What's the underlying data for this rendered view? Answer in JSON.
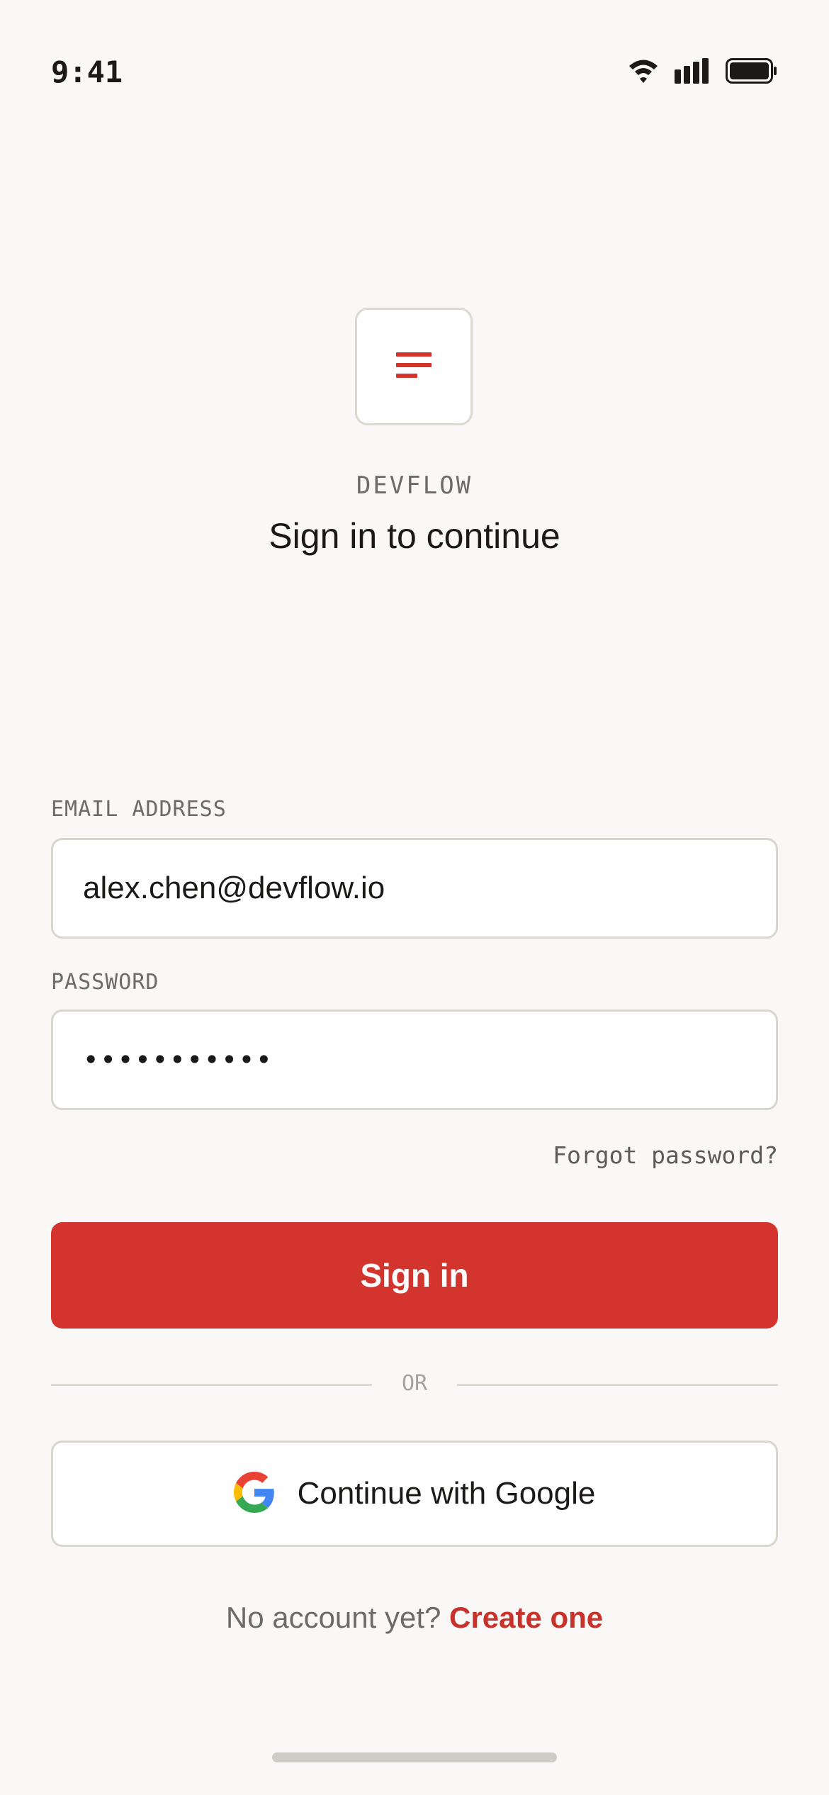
{
  "status_bar": {
    "time": "9:41"
  },
  "brand": {
    "name": "DEVFLOW",
    "accent_color": "#d3342e"
  },
  "heading": "Sign in to continue",
  "form": {
    "email": {
      "label": "EMAIL ADDRESS",
      "value": "alex.chen@devflow.io"
    },
    "password": {
      "label": "PASSWORD",
      "masked_value": "•••••••••••"
    },
    "forgot_password": "Forgot password?",
    "submit_label": "Sign in"
  },
  "divider": "OR",
  "social_login": {
    "google_label": "Continue with Google",
    "icon": "google-icon"
  },
  "footer": {
    "prompt": "No account yet?",
    "link": "Create one"
  },
  "icons": {
    "wifi": "wifi-icon",
    "signal": "signal-icon",
    "battery": "battery-icon",
    "logo": "menu-lines-icon"
  }
}
